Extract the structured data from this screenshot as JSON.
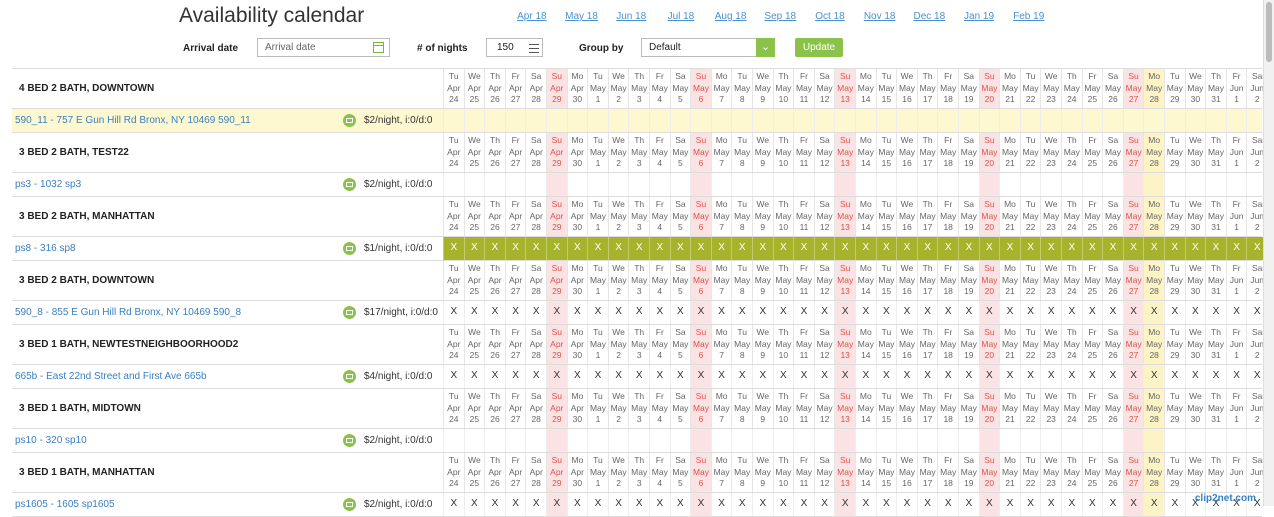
{
  "page": {
    "title": "Availability calendar"
  },
  "months": [
    "Apr 18",
    "May 18",
    "Jun 18",
    "Jul 18",
    "Aug 18",
    "Sep 18",
    "Oct 18",
    "Nov 18",
    "Dec 18",
    "Jan 19",
    "Feb 19"
  ],
  "form": {
    "arrival_label": "Arrival date",
    "arrival_placeholder": "Arrival date",
    "nights_label": "# of nights",
    "nights_value": "150",
    "group_label": "Group by",
    "group_value": "Default",
    "update_label": "Update"
  },
  "days": [
    {
      "w": "Tu",
      "m": "Apr",
      "d": "24"
    },
    {
      "w": "We",
      "m": "Apr",
      "d": "25"
    },
    {
      "w": "Th",
      "m": "Apr",
      "d": "26"
    },
    {
      "w": "Fr",
      "m": "Apr",
      "d": "27"
    },
    {
      "w": "Sa",
      "m": "Apr",
      "d": "28"
    },
    {
      "w": "Su",
      "m": "Apr",
      "d": "29"
    },
    {
      "w": "Mo",
      "m": "Apr",
      "d": "30"
    },
    {
      "w": "Tu",
      "m": "May",
      "d": "1"
    },
    {
      "w": "We",
      "m": "May",
      "d": "2"
    },
    {
      "w": "Th",
      "m": "May",
      "d": "3"
    },
    {
      "w": "Fr",
      "m": "May",
      "d": "4"
    },
    {
      "w": "Sa",
      "m": "May",
      "d": "5"
    },
    {
      "w": "Su",
      "m": "May",
      "d": "6"
    },
    {
      "w": "Mo",
      "m": "May",
      "d": "7"
    },
    {
      "w": "Tu",
      "m": "May",
      "d": "8"
    },
    {
      "w": "We",
      "m": "May",
      "d": "9"
    },
    {
      "w": "Th",
      "m": "May",
      "d": "10"
    },
    {
      "w": "Fr",
      "m": "May",
      "d": "11"
    },
    {
      "w": "Sa",
      "m": "May",
      "d": "12"
    },
    {
      "w": "Su",
      "m": "May",
      "d": "13"
    },
    {
      "w": "Mo",
      "m": "May",
      "d": "14"
    },
    {
      "w": "Tu",
      "m": "May",
      "d": "15"
    },
    {
      "w": "We",
      "m": "May",
      "d": "16"
    },
    {
      "w": "Th",
      "m": "May",
      "d": "17"
    },
    {
      "w": "Fr",
      "m": "May",
      "d": "18"
    },
    {
      "w": "Sa",
      "m": "May",
      "d": "19"
    },
    {
      "w": "Su",
      "m": "May",
      "d": "20"
    },
    {
      "w": "Mo",
      "m": "May",
      "d": "21"
    },
    {
      "w": "Tu",
      "m": "May",
      "d": "22"
    },
    {
      "w": "We",
      "m": "May",
      "d": "23"
    },
    {
      "w": "Th",
      "m": "May",
      "d": "24"
    },
    {
      "w": "Fr",
      "m": "May",
      "d": "25"
    },
    {
      "w": "Sa",
      "m": "May",
      "d": "26"
    },
    {
      "w": "Su",
      "m": "May",
      "d": "27"
    },
    {
      "w": "Mo",
      "m": "May",
      "d": "28"
    },
    {
      "w": "Tu",
      "m": "May",
      "d": "29"
    },
    {
      "w": "We",
      "m": "May",
      "d": "30"
    },
    {
      "w": "Th",
      "m": "May",
      "d": "31"
    },
    {
      "w": "Fr",
      "m": "Jun",
      "d": "1"
    },
    {
      "w": "Sa",
      "m": "Jun",
      "d": "2"
    }
  ],
  "today_index": 34,
  "groups": [
    {
      "name": "4 BED 2 BATH, DOWNTOWN",
      "property": "590_11 - 757 E Gun Hill Rd Bronx, NY 10469 590_11",
      "price": "$2/night, i:0/d:0",
      "status": "empty",
      "highlight": true
    },
    {
      "name": "3 BED 2 BATH, TEST22",
      "property": "ps3 - 1032 sp3",
      "price": "$2/night, i:0/d:0",
      "status": "empty",
      "highlight": false
    },
    {
      "name": "3 BED 2 BATH, MANHATTAN",
      "property": "ps8 - 316 sp8",
      "price": "$1/night, i:0/d:0",
      "status": "full",
      "highlight": false
    },
    {
      "name": "3 BED 2 BATH, DOWNTOWN",
      "property": "590_8 - 855 E Gun Hill Rd Bronx, NY 10469 590_8",
      "price": "$17/night, i:0/d:0",
      "status": "x",
      "highlight": false
    },
    {
      "name": "3 BED 1 BATH, NEWTESTNEIGHBOORHOOD2",
      "property": "665b - East 22nd Street and First Ave 665b",
      "price": "$4/night, i:0/d:0",
      "status": "x",
      "highlight": false
    },
    {
      "name": "3 BED 1 BATH, MIDTOWN",
      "property": "ps10 - 320 sp10",
      "price": "$2/night, i:0/d:0",
      "status": "empty",
      "highlight": false
    },
    {
      "name": "3 BED 1 BATH, MANHATTAN",
      "property": "ps1605 - 1605 sp1605",
      "price": "$2/night, i:0/d:0",
      "status": "x",
      "highlight": false
    }
  ],
  "cell_mark": "X",
  "watermark": "clip2net.com"
}
